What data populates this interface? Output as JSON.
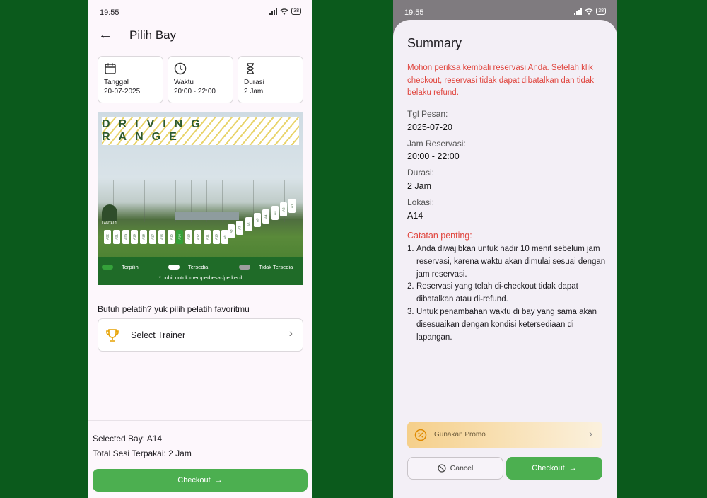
{
  "left": {
    "status_time": "19:55",
    "battery": "38",
    "title": "Pilih Bay",
    "info": [
      {
        "icon": "calendar-icon",
        "label": "Tanggal",
        "value": "20-07-2025"
      },
      {
        "icon": "clock-icon",
        "label": "Waktu",
        "value": "20:00 - 22:00"
      },
      {
        "icon": "hourglass-icon",
        "label": "Durasi",
        "value": "2 Jam"
      }
    ],
    "range": {
      "banner": "DRIVING RANGE",
      "floor_label": "LANTAI 1",
      "bays": [
        "A22",
        "A21",
        "A20",
        "A19",
        "A18",
        "A17",
        "A16",
        "A15",
        "A14",
        "A13",
        "A12",
        "A11",
        "A10",
        "A9",
        "A8",
        "A7",
        "A6",
        "A5",
        "A4",
        "A3",
        "A2",
        "A1"
      ],
      "selected_bay": "A14",
      "legend": {
        "selected": "Terpilih",
        "available": "Tersedia",
        "unavailable": "Tidak Tersedia"
      },
      "note": "* cubit untuk memperbesar/perkecil"
    },
    "trainer_prompt": "Butuh pelatih? yuk pilih pelatih favoritmu",
    "trainer_button": "Select Trainer",
    "selected_bay_line": "Selected Bay: A14",
    "total_line": "Total Sesi Terpakai: 2 Jam",
    "checkout": "Checkout"
  },
  "right": {
    "status_time": "19:55",
    "battery": "38",
    "title": "Summary",
    "warning": "Mohon periksa kembali reservasi Anda. Setelah klik checkout, reservasi tidak dapat dibatalkan dan tidak belaku refund.",
    "fields": [
      {
        "label": "Tgl Pesan:",
        "value": "2025-07-20"
      },
      {
        "label": "Jam Reservasi:",
        "value": "20:00 - 22:00"
      },
      {
        "label": "Durasi:",
        "value": "2 Jam"
      },
      {
        "label": "Lokasi:",
        "value": "A14"
      }
    ],
    "notes_title": "Catatan penting:",
    "notes": [
      "Anda diwajibkan untuk hadir 10 menit sebelum jam reservasi, karena waktu akan dimulai sesuai dengan jam reservasi.",
      "Reservasi yang telah di-checkout tidak dapat dibatalkan atau di-refund.",
      "Untuk penambahan waktu di bay yang sama akan disesuaikan dengan kondisi ketersediaan di lapangan."
    ],
    "promo": "Gunakan Promo",
    "cancel": "Cancel",
    "checkout": "Checkout"
  },
  "colors": {
    "background": "#0b5a1c",
    "primary_green": "#4caf50",
    "warning_red": "#e0463f"
  }
}
